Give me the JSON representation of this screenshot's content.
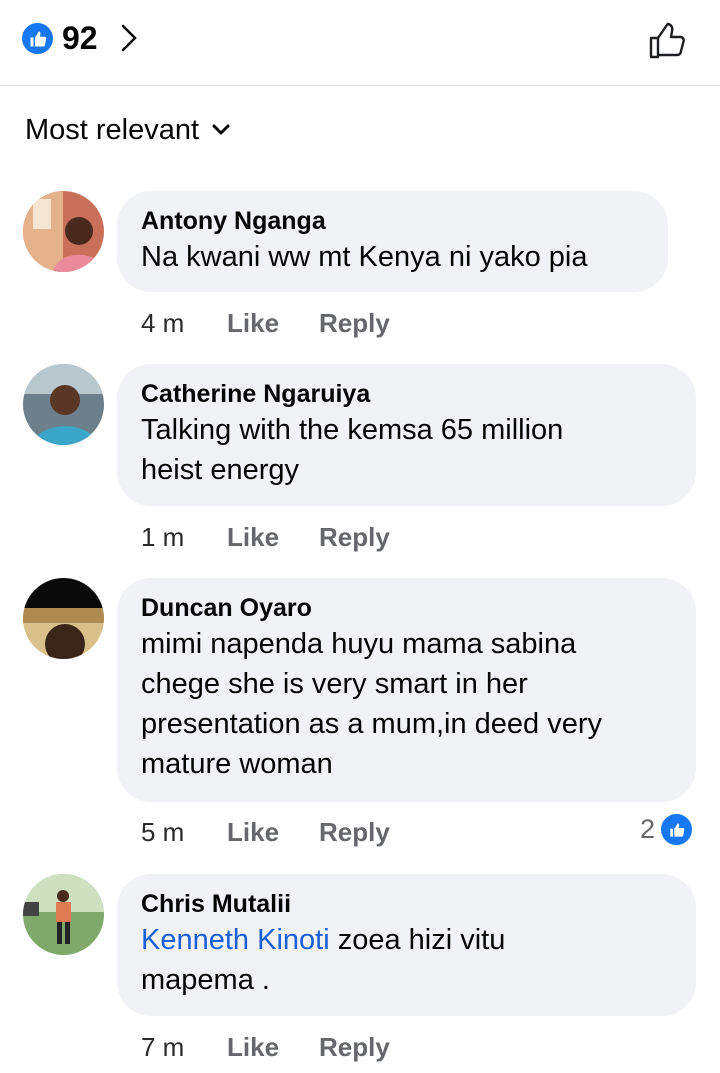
{
  "header": {
    "reaction_count": "92",
    "reaction_icon": "thumbs-up-icon",
    "colors": {
      "like_blue": "#1877f2"
    }
  },
  "sort": {
    "label": "Most relevant"
  },
  "comments": [
    {
      "author": "Antony Nganga",
      "text": "Na kwani ww mt Kenya ni yako pia",
      "time": "4 m",
      "like_label": "Like",
      "reply_label": "Reply"
    },
    {
      "author": "Catherine Ngaruiya",
      "text_line1": "Talking with the kemsa 65 million",
      "text_line2": "heist energy",
      "time": "1 m",
      "like_label": "Like",
      "reply_label": "Reply"
    },
    {
      "author": "Duncan Oyaro",
      "text_line1": "mimi napenda huyu mama sabina",
      "text_line2": "chege she is very smart in her",
      "text_line3": "presentation as a mum,in deed very",
      "text_line4": "mature woman",
      "time": "5 m",
      "like_label": "Like",
      "reply_label": "Reply",
      "reaction_count": "2"
    },
    {
      "author": "Chris Mutalii",
      "mention": "Kenneth Kinoti",
      "text_after_mention": " zoea hizi vitu",
      "text_line2": "mapema .",
      "time": "7 m",
      "like_label": "Like",
      "reply_label": "Reply"
    }
  ]
}
